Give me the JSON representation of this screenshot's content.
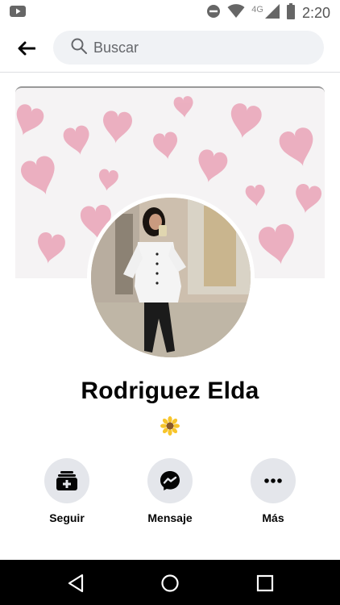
{
  "status_bar": {
    "time": "2:20",
    "network": "4G",
    "icons": [
      "youtube-icon",
      "do-not-disturb-icon",
      "wifi-icon",
      "signal-icon",
      "battery-icon"
    ]
  },
  "app_bar": {
    "back_icon": "arrow-left-icon",
    "search_placeholder": "Buscar"
  },
  "profile": {
    "name": "Rodriguez Elda",
    "bio_icon": "sunflower-emoji",
    "cover_theme": "pink watercolor hearts",
    "avatar_alt": "profile photo"
  },
  "actions": [
    {
      "label": "Seguir",
      "icon": "add-friend-icon"
    },
    {
      "label": "Mensaje",
      "icon": "messenger-icon"
    },
    {
      "label": "Más",
      "icon": "more-dots-icon"
    }
  ],
  "nav_bar": {
    "icons": [
      "nav-back-icon",
      "nav-home-icon",
      "nav-recents-icon"
    ]
  },
  "colors": {
    "accent_bg": "#e4e6eb",
    "search_bg": "#f0f2f5",
    "heart_pink": "#e9a2b6",
    "text_primary": "#050505"
  }
}
